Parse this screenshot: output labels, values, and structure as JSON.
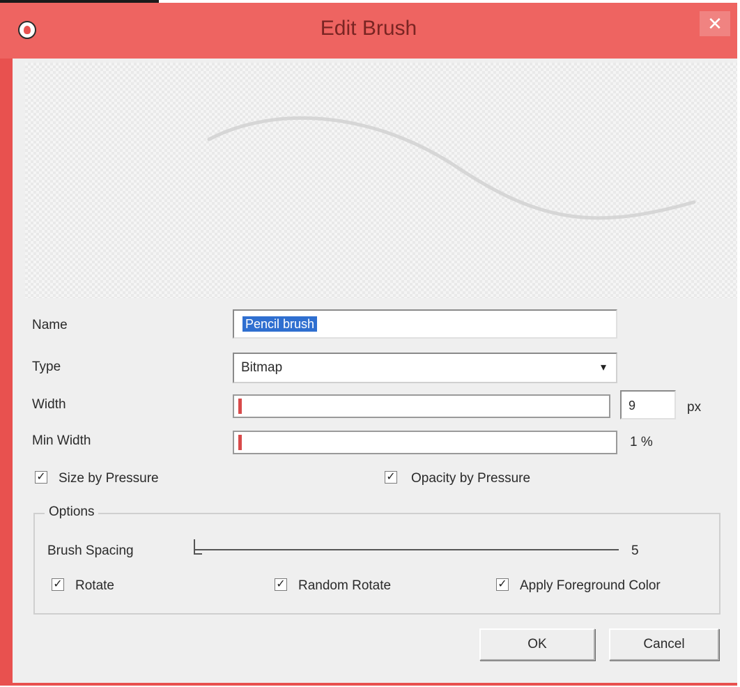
{
  "window": {
    "title": "Edit Brush",
    "app_icon": "app-logo-icon",
    "close_glyph": "✕"
  },
  "preview": {
    "stroke_color": "#d6d6d6"
  },
  "form": {
    "name_label": "Name",
    "name_value": "Pencil brush",
    "type_label": "Type",
    "type_value": "Bitmap",
    "dropdown_glyph": "▾",
    "width_label": "Width",
    "width_value": "9",
    "width_unit": "px",
    "width_fraction": 0.01,
    "min_width_label": "Min Width",
    "min_width_value": "1 %",
    "min_width_fraction": 0.01,
    "size_by_pressure_label": "Size by Pressure",
    "size_by_pressure_checked": true,
    "opacity_by_pressure_label": "Opacity by Pressure",
    "opacity_by_pressure_checked": true
  },
  "options": {
    "legend": "Options",
    "brush_spacing_label": "Brush Spacing",
    "brush_spacing_value": "5",
    "rotate_label": "Rotate",
    "random_rotate_label": "Random Rotate",
    "apply_foreground_label": "Apply Foreground Color",
    "check_glyph": "✓"
  },
  "buttons": {
    "ok": "OK",
    "cancel": "Cancel"
  },
  "colors": {
    "titlebar": "#ee6461",
    "frame": "#e8514f",
    "slider_fill": "#d84a4a",
    "selection": "#2f6fd0"
  }
}
